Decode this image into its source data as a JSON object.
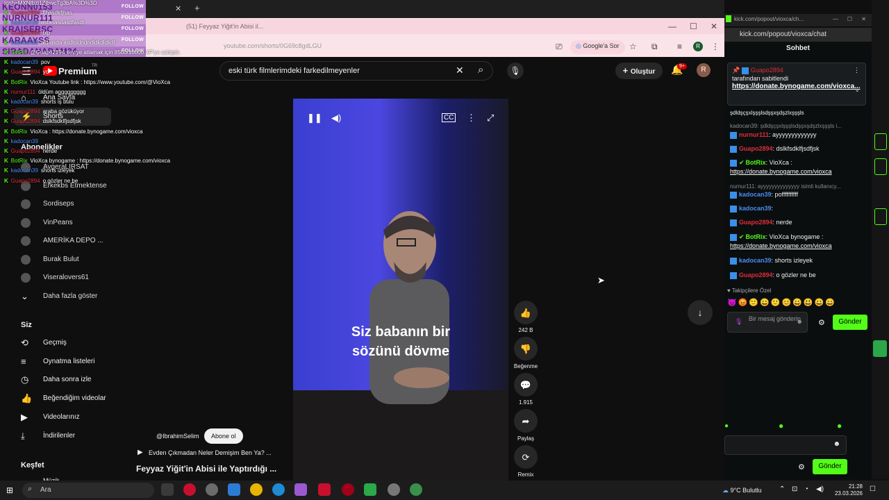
{
  "follow_overlay": {
    "rows": [
      "KEONN0153",
      "NURNUR111",
      "KRAISERSC",
      "KARAAYSS",
      "SIRADANADAM34"
    ],
    "label": "FOLLOW"
  },
  "browser": {
    "tab_title": "(51) Feyyaz Yiğit'in Abisi il...",
    "url": "youtube.com/shorts/0G69c8gdLGU",
    "google_sor": "Google'a Sor",
    "profile_initial": "R"
  },
  "youtube": {
    "logo": "Premium",
    "logo_sup": "TR",
    "search_query": "eski türk filmlerimdeki farkedilmeyenler",
    "create_label": "Oluştur",
    "notif_badge": "9+",
    "avatar": "R",
    "nav_top": [
      {
        "label": "Ana Sayfa",
        "icon": "home-icon",
        "glyph": "⌂"
      },
      {
        "label": "Shorts",
        "icon": "shorts-icon",
        "glyph": "⚡"
      }
    ],
    "subs_header": "Abonelikler",
    "subs": [
      "AvgeraLIRSAT",
      "Erkekbs Etmektense",
      "Sordiseps",
      "VinPeans",
      "AMERİKA DEPO ...",
      "Burak Bulut",
      "Viseralovers61",
      "Daha fazla göster"
    ],
    "siz_header": "Siz",
    "nav_you": [
      {
        "label": "Geçmiş",
        "icon": "history-icon",
        "glyph": "⟲"
      },
      {
        "label": "Oynatma listeleri",
        "icon": "playlist-icon",
        "glyph": "≡"
      },
      {
        "label": "Daha sonra izle",
        "icon": "clock-icon",
        "glyph": "◷"
      },
      {
        "label": "Beğendiğim videolar",
        "icon": "like-icon",
        "glyph": "👍"
      },
      {
        "label": "Videolarınız",
        "icon": "video-icon",
        "glyph": "▶"
      },
      {
        "label": "İndirilenler",
        "icon": "download-icon",
        "glyph": "⤓"
      }
    ],
    "explore_header": "Keşfet",
    "explore_item": "Müzik",
    "caption_line1": "Siz babanın bir",
    "caption_line2": "sözünü dövme",
    "actions": [
      {
        "name": "like",
        "glyph": "👍",
        "label": "242 B"
      },
      {
        "name": "dislike",
        "glyph": "👎",
        "label": "Beğenme"
      },
      {
        "name": "comments",
        "glyph": "💬",
        "label": "1.915"
      },
      {
        "name": "share",
        "glyph": "➦",
        "label": "Paylaş"
      },
      {
        "name": "remix",
        "glyph": "⟳",
        "label": "Remix"
      }
    ],
    "channel": "@IbrahimSelim",
    "subscribe": "Abone ol",
    "related_link": "Evden Çıkmadan Neler Demişim Ben Ya? ...",
    "video_title": "Feyyaz Yiğit'in Abisi ile Yaptırdığı ..."
  },
  "chat_overlay": [
    {
      "user": "",
      "text": "Igsh=MXNtbzl1ZjbwcTg3bA%3D%3D",
      "color": "#ffffff"
    },
    {
      "user": "Guapo2894",
      "text": "fjhasdkfjhas",
      "color": "#e02d3a"
    },
    {
      "user": "kadocan39",
      "text": "asfasasdasdfasdl",
      "color": "#4b8bf5"
    },
    {
      "user": "Guapo2894",
      "text": "txp",
      "color": "#e02d3a"
    },
    {
      "user": "kadocan39",
      "text": "aldıasda asdlsldndndldkdldkdl",
      "color": "#4b8bf5"
    },
    {
      "user": "BotRix",
      "text": "@Guapo2894 seviye atlamak için 8500/10000 XP'ye sahiptir.",
      "color": "#53fc18"
    },
    {
      "user": "kadocan39",
      "text": "pov",
      "color": "#4b8bf5"
    },
    {
      "user": "Guapo2894",
      "text": "yo",
      "color": "#e02d3a"
    },
    {
      "user": "BotRix",
      "text": "VioXca Youtube link : https://www.youtube.com/@VioXca",
      "color": "#53fc18"
    },
    {
      "user": "nurnur111",
      "text": "öldüm aggggggggg",
      "color": "#e02d3a"
    },
    {
      "user": "kadocan39",
      "text": "shorts iş bulu",
      "color": "#4b8bf5"
    },
    {
      "user": "Guapo2894",
      "text": "araba gözüküyor",
      "color": "#e02d3a"
    },
    {
      "user": "Guapo2894",
      "text": "dslkfsdklfjsdfjsk",
      "color": "#e02d3a"
    },
    {
      "user": "BotRix",
      "text": "VioXca : https://donate.bynogame.com/vioxca",
      "color": "#53fc18"
    },
    {
      "user": "kadocan39",
      "text": "",
      "color": "#4b8bf5"
    },
    {
      "user": "Guapo2894",
      "text": "nerde",
      "color": "#e02d3a"
    },
    {
      "user": "BotRix",
      "text": "VioXca bynogame : https://donate.bynogame.com/vioxca",
      "color": "#53fc18"
    },
    {
      "user": "kadocan39",
      "text": "shorts izleyek",
      "color": "#4b8bf5"
    },
    {
      "user": "Guapo2894",
      "text": "o gözler ne be",
      "color": "#e02d3a"
    }
  ],
  "kick": {
    "window_title": "kick.com/popout/vioxca/ch...",
    "url": "kick.com/popout/vioxca/chat",
    "header": "Sohbet",
    "pinned_user": "Guapo2894",
    "pinned_by": "tarafından sabitlendi",
    "pinned_link": "https://donate.bynogame.com/vioxca...",
    "messages": [
      {
        "user": "",
        "text": "şdldşçşxlşşşlsdşşxşdşzlxşşşls",
        "ucls": "",
        "link": ""
      },
      {
        "user": "",
        "text": "kadocan39: şdldşçşxlşşşlsdşşxşdşzlxşşşls i...",
        "ucls": "grey",
        "link": ""
      },
      {
        "user": "nurnur111",
        "text": ": ayyyyyyyyyyyyy",
        "ucls": "red",
        "link": ""
      },
      {
        "user": "Guapo2894",
        "text": ": dslkfsdklfjsdfjsk",
        "ucls": "red",
        "link": ""
      },
      {
        "user": "BotRix",
        "text": ": VioXca :",
        "ucls": "green",
        "link": "https://donate.bynogame.com/vioxca"
      },
      {
        "user": "",
        "text": "nurnur111: ayyyyyyyyyyyyyy isimli kullanıcy...",
        "ucls": "grey",
        "link": ""
      },
      {
        "user": "kadocan39",
        "text": ": poffffffffff",
        "ucls": "blue",
        "link": ""
      },
      {
        "user": "kadocan39",
        "text": ":",
        "ucls": "blue",
        "link": ""
      },
      {
        "user": "Guapo2894",
        "text": ": nerde",
        "ucls": "red",
        "link": ""
      },
      {
        "user": "BotRix",
        "text": ": VioXca bynogame :",
        "ucls": "green",
        "link": "https://donate.bynogame.com/vioxca"
      },
      {
        "user": "kadocan39",
        "text": ": shorts izleyek",
        "ucls": "blue",
        "link": ""
      },
      {
        "user": "Guapo2894",
        "text": ": o gözler ne be",
        "ucls": "red",
        "link": ""
      }
    ],
    "followers_only": "Takipçilere Özel",
    "emotes": "😈😡🙂😀🙂😊😀😃😀😄",
    "input_placeholder": "Bir mesaj gönderin",
    "send": "Gönder"
  },
  "taskbar": {
    "search_placeholder": "Ara",
    "weather": "9°C  Bulutlu",
    "time": "21:28",
    "date": "23.03.2026"
  },
  "colors": {
    "yt_bg": "#0f0f0f",
    "kick_green": "#53fc18",
    "yt_red": "#ff0000",
    "follow_purple": "#b078c8"
  }
}
